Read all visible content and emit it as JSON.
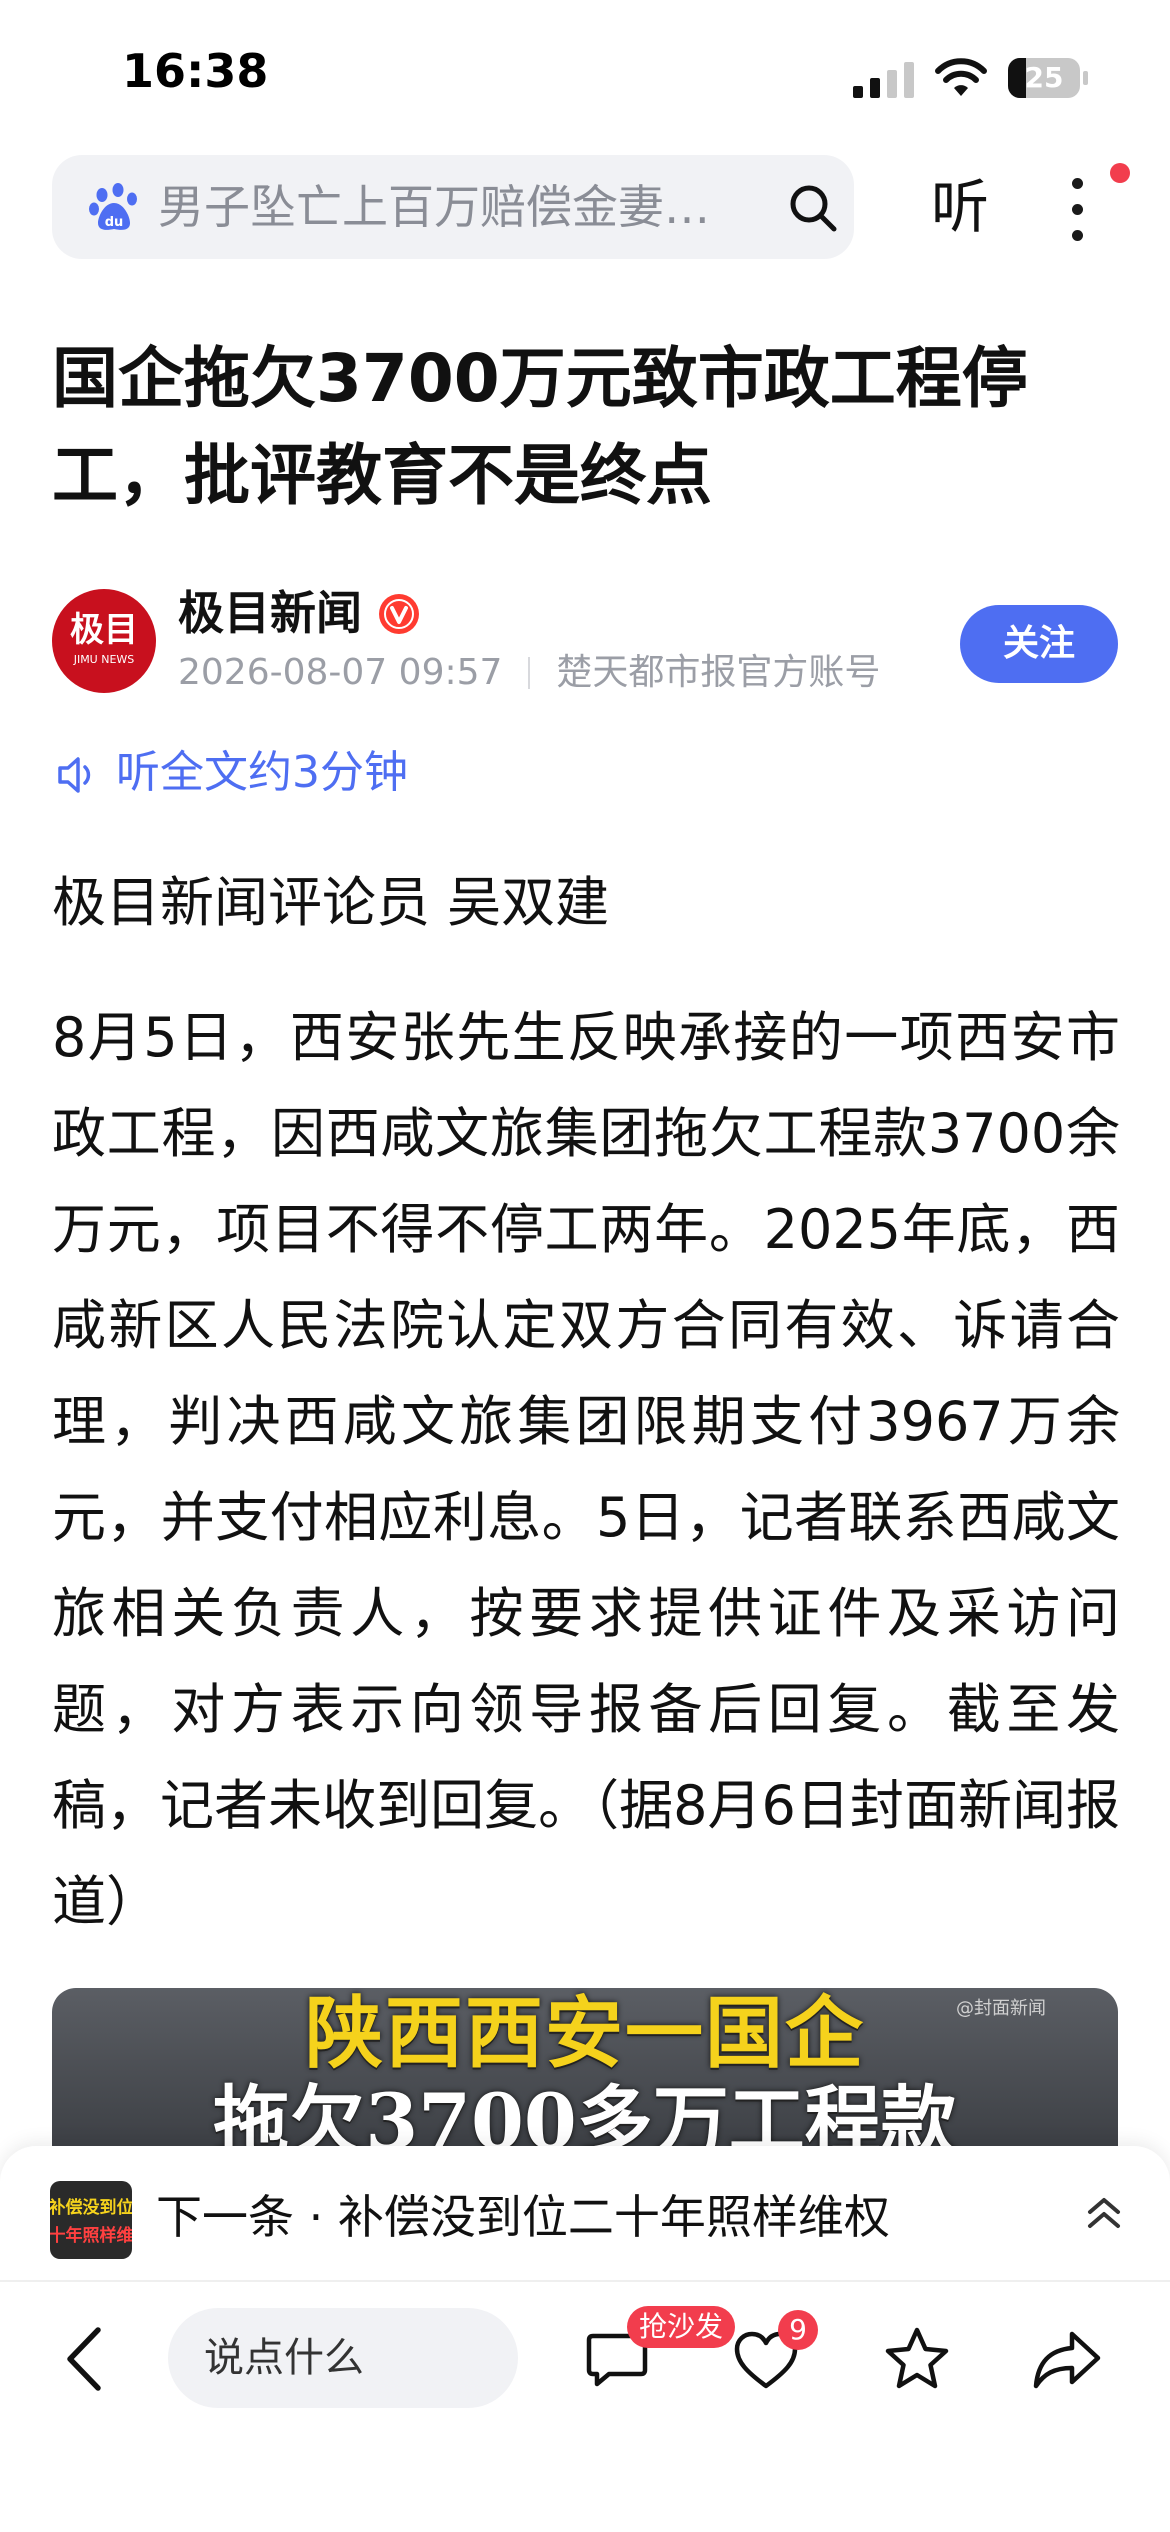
{
  "status_bar": {
    "time": "16:38",
    "battery_level": "25"
  },
  "search": {
    "query": "男子坠亡上百万赔偿金妻…",
    "listen_label": "听"
  },
  "article": {
    "title": "国企拖欠3700万元致市政工程停工，批评教育不是终点",
    "author": {
      "name": "极目新闻",
      "avatar_text": "极目",
      "avatar_subtext": "JIMU NEWS",
      "date": "2026-08-07 09:57",
      "source": "楚天都市报官方账号",
      "follow_label": "关注"
    },
    "listen_full": "听全文约3分钟",
    "byline": "极目新闻评论员 吴双建",
    "paragraph": "8月5日，西安张先生反映承接的一项西安市政工程，因西咸文旅集团拖欠工程款3700余万元，项目不得不停工两年。2025年底，西咸新区人民法院认定双方合同有效、诉请合理，判决西咸文旅集团限期支付3967万余元，并支付相应利息。5日，记者联系西咸文旅相关负责人，按要求提供证件及采访问题，对方表示向领导报备后回复。截至发稿，记者未收到回复。（据8月6日封面新闻报道）",
    "video": {
      "line1": "陕西西安一国企",
      "line2": "拖欠3700多万工程款",
      "watermark": "@封面新闻"
    }
  },
  "next": {
    "thumb_line1": "补偿没到位",
    "thumb_line2": "十年照样维",
    "text": "下一条 · 补偿没到位二十年照样维权"
  },
  "toolbar": {
    "comment_placeholder": "说点什么",
    "sofa_badge": "抢沙发",
    "like_count": "9"
  },
  "colors": {
    "accent": "#4e6ef2",
    "badge_red": "#f23d4d",
    "brand_red": "#c8101e"
  }
}
